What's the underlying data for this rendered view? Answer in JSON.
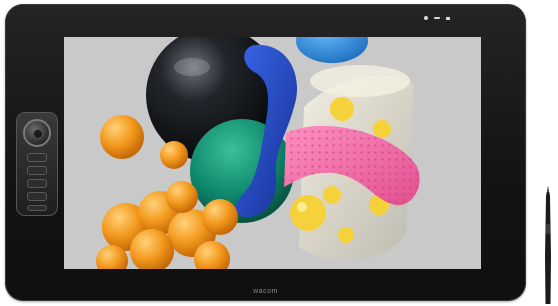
{
  "device": {
    "logo_text": "wacom",
    "bezel_color": "#161616",
    "accent_led_color": "#d8d8d8"
  },
  "artwork": {
    "background_color": "#c9c9c9",
    "colors": {
      "black_sphere": "#161a1f",
      "blue_tube": "#1f45c7",
      "orange": "#f39a1e",
      "green": "#0f8a6e",
      "pink": "#f06aa7",
      "yellow": "#f6d23a",
      "glass": "#e9e6d8",
      "sky_blue": "#2f8ee0"
    }
  }
}
